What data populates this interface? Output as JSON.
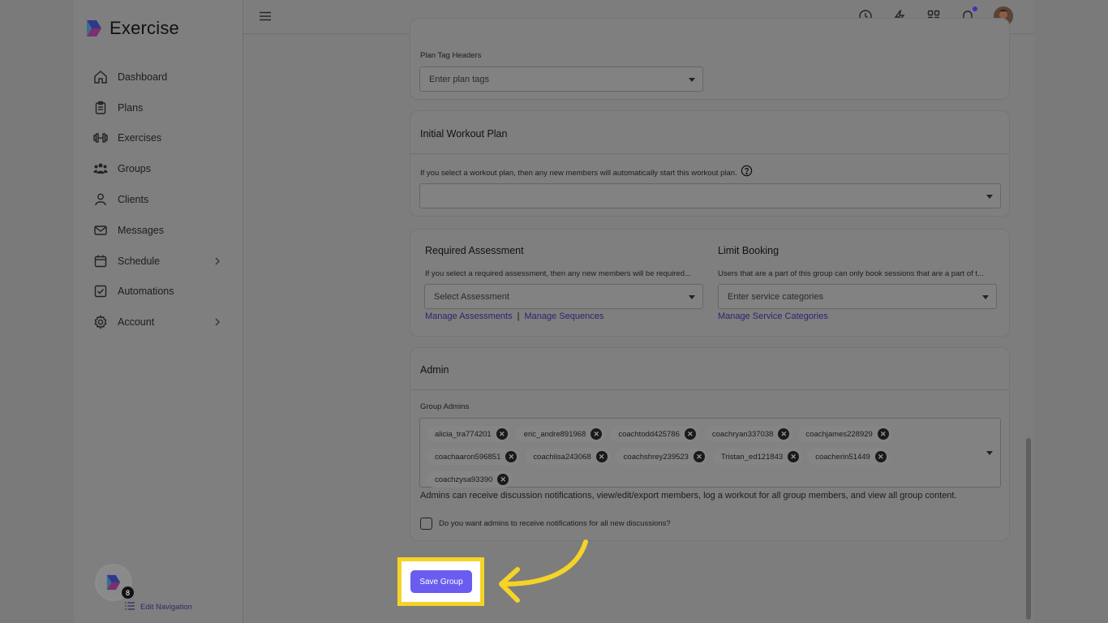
{
  "app": {
    "title": "Exercise"
  },
  "sidebar": {
    "items": [
      {
        "label": "Dashboard",
        "icon": "home-icon",
        "chevron": false
      },
      {
        "label": "Plans",
        "icon": "clipboard-icon",
        "chevron": false
      },
      {
        "label": "Exercises",
        "icon": "dumbbell-icon",
        "chevron": false
      },
      {
        "label": "Groups",
        "icon": "users-icon",
        "chevron": false
      },
      {
        "label": "Clients",
        "icon": "user-icon",
        "chevron": false
      },
      {
        "label": "Messages",
        "icon": "mail-icon",
        "chevron": false
      },
      {
        "label": "Schedule",
        "icon": "calendar-icon",
        "chevron": true
      },
      {
        "label": "Automations",
        "icon": "check-square-icon",
        "chevron": false
      },
      {
        "label": "Account",
        "icon": "gear-icon",
        "chevron": true
      }
    ],
    "badge_count": "8",
    "edit_nav_label": "Edit Navigation"
  },
  "plan_tags": {
    "label": "Plan Tag Headers",
    "placeholder": "Enter plan tags"
  },
  "initial_plan": {
    "title": "Initial Workout Plan",
    "description": "If you select a workout plan, then any new members will automatically start this workout plan.",
    "value": ""
  },
  "assessment": {
    "title": "Required Assessment",
    "description": "If you select a required assessment, then any new members will be required...",
    "placeholder": "Select Assessment",
    "link1": "Manage Assessments",
    "separator": "|",
    "link2": "Manage Sequences"
  },
  "booking": {
    "title": "Limit Booking",
    "description": "Users that are a part of this group can only book sessions that are a part of t...",
    "placeholder": "Enter service categories",
    "link": "Manage Service Categories"
  },
  "admin": {
    "title": "Admin",
    "group_admins_label": "Group Admins",
    "admins": [
      "alicia_tra774201",
      "eric_andre891968",
      "coachtodd425786",
      "coachryan337038",
      "coachjames228929",
      "coachaaron596851",
      "coachlisa243068",
      "coachshrey239523",
      "Tristan_ed121843",
      "coacherin51449",
      "coachzysa93390"
    ],
    "help_text": "Admins can receive discussion notifications, view/edit/export members, log a workout for all group members, and view all group content.",
    "checkbox_label": "Do you want admins to receive notifications for all new discussions?"
  },
  "save_button": {
    "label": "Save Group"
  },
  "colors": {
    "accent": "#6b5cf0",
    "highlight": "#f5d327",
    "link": "#2b2570"
  }
}
